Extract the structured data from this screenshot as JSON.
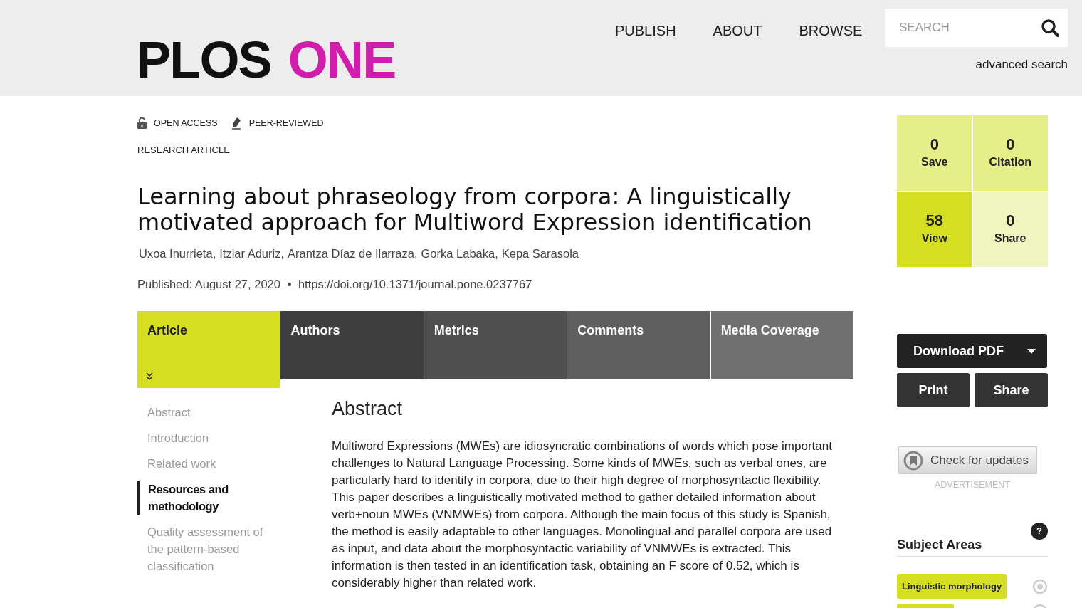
{
  "header": {
    "logo": [
      "PLOS",
      "ONE"
    ],
    "nav": [
      "PUBLISH",
      "ABOUT",
      "BROWSE"
    ],
    "search": {
      "placeholder": "SEARCH"
    },
    "advanced_search": "advanced search"
  },
  "badges": [
    {
      "kind": "lock",
      "label": "OPEN ACCESS"
    },
    {
      "kind": "pen",
      "label": "PEER-REVIEWED"
    }
  ],
  "article_type": "RESEARCH ARTICLE",
  "title": "Learning about phraseology from corpora: A linguistically motivated approach for Multiword Expression identification",
  "authors": [
    "Uxoa Inurrieta,",
    "Itziar Aduriz,",
    "Arantza Díaz de Ilarraza,",
    "Gorka Labaka,",
    "Kepa Sarasola"
  ],
  "published": "Published: August 27, 2020",
  "doi": "https://doi.org/10.1371/journal.pone.0237767",
  "tabs": [
    {
      "label": "Article",
      "selected": true,
      "color": "#d5de22"
    },
    {
      "label": "Authors",
      "selected": false,
      "color": "#3e3e3e"
    },
    {
      "label": "Metrics",
      "selected": false,
      "color": "#4f4f4f"
    },
    {
      "label": "Comments",
      "selected": false,
      "color": "#5f5f5f"
    },
    {
      "label": "Media Coverage",
      "selected": false,
      "color": "#707070"
    }
  ],
  "toc": [
    {
      "label": "Abstract",
      "selected": false
    },
    {
      "label": "Introduction",
      "selected": false
    },
    {
      "label": "Related work",
      "selected": false
    },
    {
      "label": "Resources and methodology",
      "selected": true
    },
    {
      "label": "Quality assessment of the pattern-based classification",
      "selected": false
    }
  ],
  "abstract": {
    "heading": "Abstract",
    "text": "Multiword Expressions (MWEs) are idiosyncratic combinations of words which pose important challenges to Natural Language Processing. Some kinds of MWEs, such as verbal ones, are particularly hard to identify in corpora, due to their high degree of morphosyntactic flexibility. This paper describes a linguistically motivated method to gather detailed information about verb+noun MWEs (VNMWEs) from corpora. Although the main focus of this study is Spanish, the method is easily adaptable to other languages. Monolingual and parallel corpora are used as input, and data about the morphosyntactic variability of VNMWEs is extracted. This information is then tested in an identification task, obtaining an F score of 0.52, which is considerably higher than related work."
  },
  "metrics": [
    {
      "count": "0",
      "label": "Save",
      "color": "#e6ee8a"
    },
    {
      "count": "0",
      "label": "Citation",
      "color": "#e6ee8a"
    },
    {
      "count": "58",
      "label": "View",
      "color": "#d5de22"
    },
    {
      "count": "0",
      "label": "Share",
      "color": "#f0f4bf"
    }
  ],
  "actions": {
    "download": "Download PDF",
    "print": "Print",
    "share": "Share"
  },
  "updates": "Check for updates",
  "advertisement": "ADVERTISEMENT",
  "subject_areas": {
    "heading": "Subject Areas",
    "help": "?",
    "tags": [
      "Linguistic morphology"
    ]
  }
}
